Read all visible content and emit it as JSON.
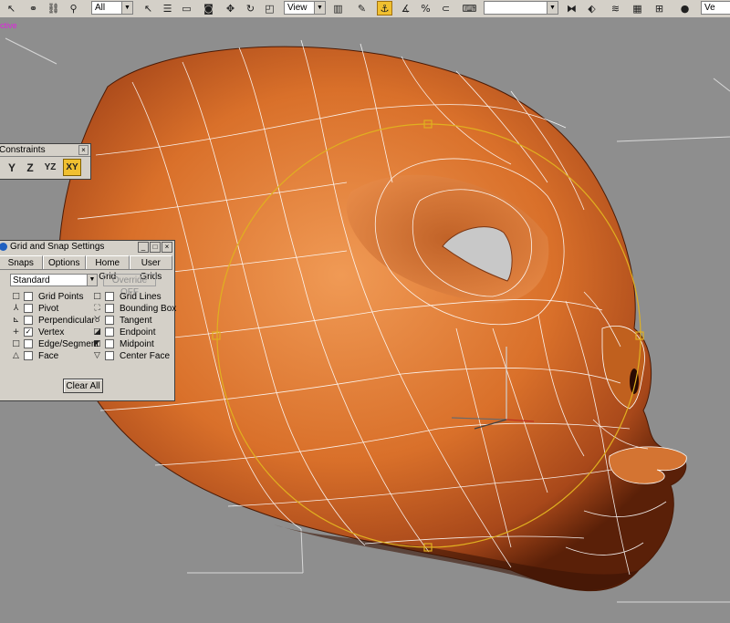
{
  "toolbar": {
    "selection_filter": "All",
    "reference_coord": "View",
    "right_combo_text": "",
    "far_right_label": "Ve"
  },
  "viewport": {
    "label": "ctive"
  },
  "constraints": {
    "title": "Constraints",
    "buttons": [
      "Y",
      "Z",
      "YZ",
      "XY"
    ],
    "active": "XY"
  },
  "grid_snap": {
    "title": "Grid and Snap Settings",
    "tabs": [
      "Snaps",
      "Options",
      "Home Grid",
      "User Grids"
    ],
    "preset": "Standard",
    "override": "Override OFF",
    "left_column": [
      {
        "label": "Grid Points",
        "checked": false,
        "icon": "grid-points-icon",
        "glyph": "□"
      },
      {
        "label": "Pivot",
        "checked": false,
        "icon": "pivot-icon",
        "glyph": "⅄"
      },
      {
        "label": "Perpendicular",
        "checked": false,
        "icon": "perpendicular-icon",
        "glyph": "⊾"
      },
      {
        "label": "Vertex",
        "checked": true,
        "icon": "vertex-icon",
        "glyph": "+"
      },
      {
        "label": "Edge/Segment",
        "checked": false,
        "icon": "edge-icon",
        "glyph": "□"
      },
      {
        "label": "Face",
        "checked": false,
        "icon": "face-icon",
        "glyph": "△"
      }
    ],
    "right_column": [
      {
        "label": "Grid Lines",
        "checked": false,
        "icon": "grid-lines-icon",
        "glyph": "□"
      },
      {
        "label": "Bounding Box",
        "checked": false,
        "icon": "bounding-box-icon",
        "glyph": "⛶"
      },
      {
        "label": "Tangent",
        "checked": false,
        "icon": "tangent-icon",
        "glyph": "♉"
      },
      {
        "label": "Endpoint",
        "checked": false,
        "icon": "endpoint-icon",
        "glyph": "◪"
      },
      {
        "label": "Midpoint",
        "checked": false,
        "icon": "midpoint-icon",
        "glyph": "◩"
      },
      {
        "label": "Center Face",
        "checked": false,
        "icon": "center-face-icon",
        "glyph": "▽"
      }
    ],
    "clear_all": "Clear All"
  },
  "colors": {
    "viewport_bg": "#8e8e8e",
    "head_orange": "#d9702a",
    "wire": "#ffffff",
    "gizmo": "#e0b020",
    "active_button": "#f0c030"
  }
}
